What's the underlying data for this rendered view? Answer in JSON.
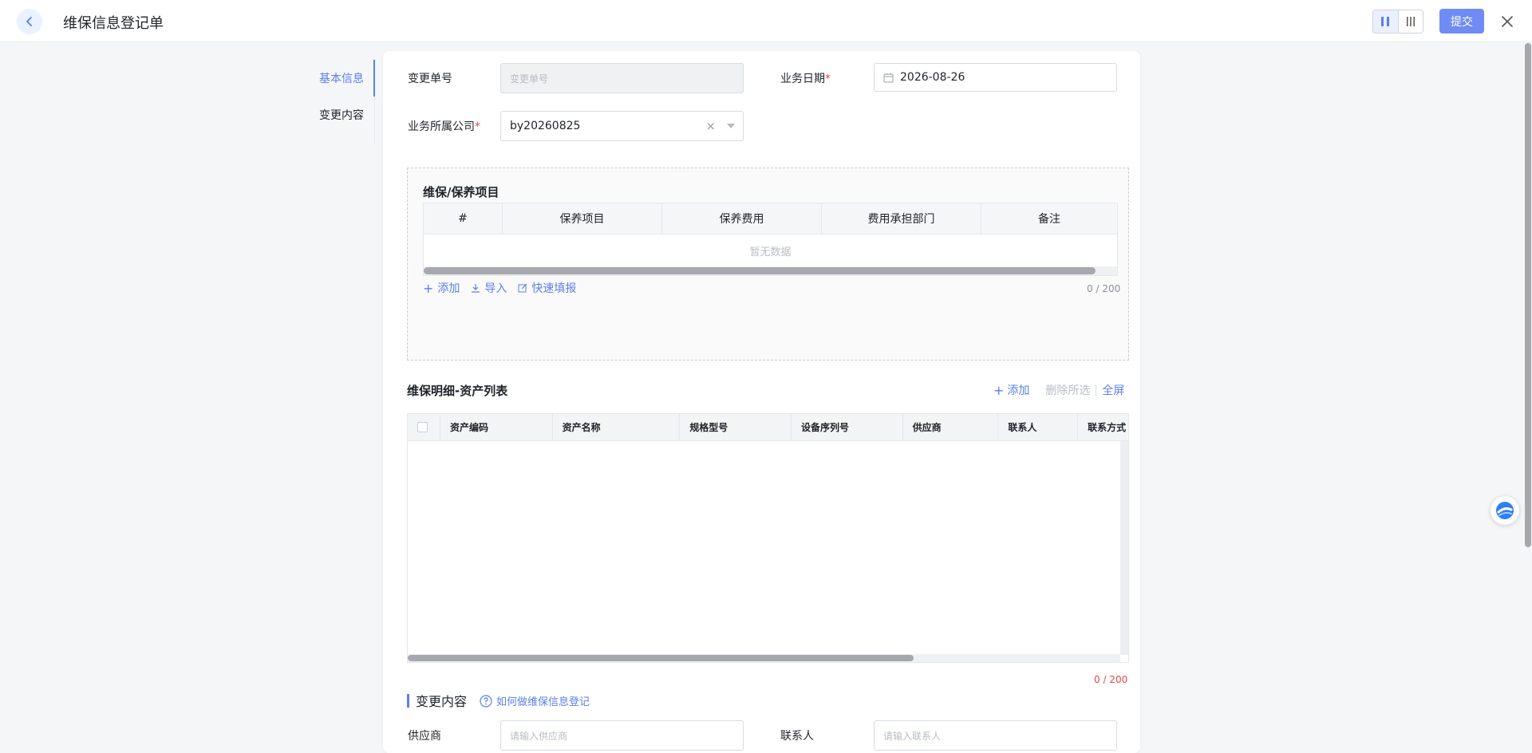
{
  "header": {
    "title": "维保信息登记单",
    "submit_label": "提交",
    "view_modes": [
      "two-column",
      "three-column"
    ]
  },
  "side_nav": {
    "items": [
      {
        "label": "基本信息",
        "active": true
      },
      {
        "label": "变更内容",
        "active": false
      }
    ]
  },
  "form": {
    "change_no": {
      "label": "变更单号",
      "placeholder": "变更单号",
      "value": ""
    },
    "biz_date": {
      "label": "业务日期",
      "required_mark": "*",
      "value": "2026-08-26"
    },
    "company": {
      "label": "业务所属公司",
      "required_mark": "*",
      "value": "by20260825"
    }
  },
  "maintenance_items": {
    "title": "维保/保养项目",
    "columns": [
      "#",
      "保养项目",
      "保养费用",
      "费用承担部门",
      "备注"
    ],
    "empty_text": "暂无数据",
    "actions": {
      "add": "添加",
      "import": "导入",
      "quick_fill": "快速填报"
    },
    "counter": "0 / 200"
  },
  "asset_list": {
    "title": "维保明细-资产列表",
    "actions": {
      "add": "添加",
      "delete_selected": "删除所选",
      "fullscreen": "全屏"
    },
    "columns": [
      "资产编码",
      "资产名称",
      "规格型号",
      "设备序列号",
      "供应商",
      "联系人",
      "联系方式"
    ],
    "counter": "0 / 200"
  },
  "change_content": {
    "title": "变更内容",
    "help_link": "如何做维保信息登记",
    "supplier": {
      "label": "供应商",
      "placeholder": "请输入供应商"
    },
    "contact": {
      "label": "联系人",
      "placeholder": "请输入联系人"
    }
  },
  "colors": {
    "accent": "#5b7ef0",
    "submit_bg": "#6f8cf5",
    "required": "#e5484d"
  }
}
